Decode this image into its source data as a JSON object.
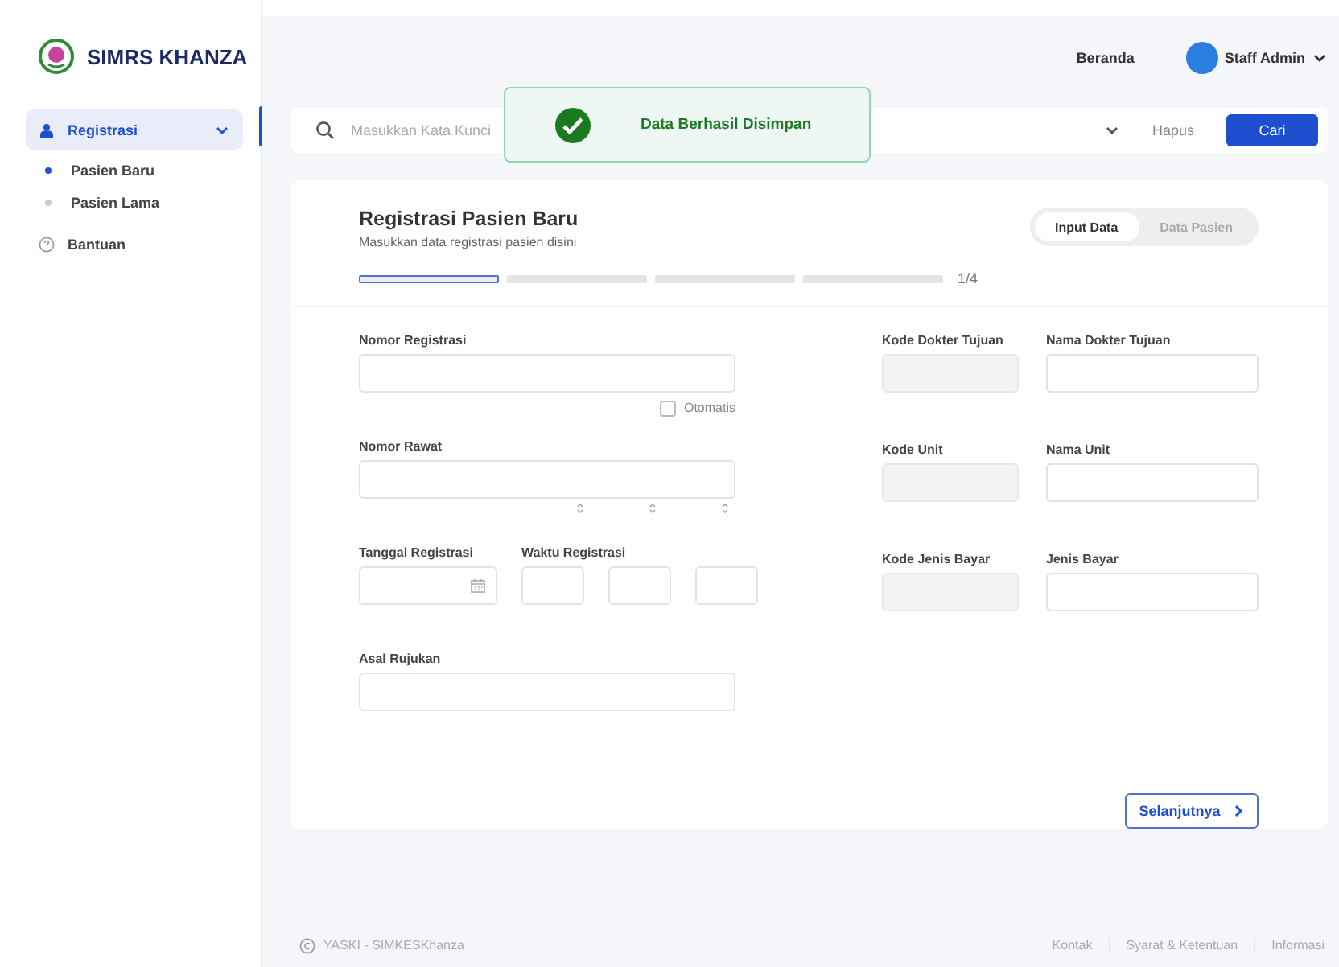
{
  "sidebar": {
    "brand": "SIMRS KHANZA",
    "items": [
      {
        "label": "Registrasi",
        "kind": "group",
        "expanded": true,
        "selected": true
      },
      {
        "label": "Pasien Baru",
        "kind": "sub",
        "selected": true
      },
      {
        "label": "Pasien Lama",
        "kind": "sub",
        "selected": false
      },
      {
        "label": "Bantuan",
        "kind": "help",
        "selected": false
      }
    ]
  },
  "header": {
    "home": "Beranda",
    "user": "Staff Admin"
  },
  "search": {
    "placeholder": "Masukkan Kata Kunci",
    "clear": "Hapus",
    "submit": "Cari"
  },
  "toast": {
    "message": "Data Berhasil Disimpan"
  },
  "card": {
    "title": "Registrasi Pasien Baru",
    "subtitle": "Masukkan data registrasi pasien disini",
    "tabs": [
      {
        "label": "Input Data",
        "selected": true
      },
      {
        "label": "Data Pasien",
        "selected": false
      }
    ],
    "progress": {
      "steps": [
        {
          "selected": true
        },
        {
          "selected": false
        },
        {
          "selected": false
        },
        {
          "selected": false
        }
      ],
      "label": "1/4"
    },
    "left": [
      {
        "kind": "text",
        "label": "Nomor Registrasi",
        "checkbox": {
          "label": "Otomatis",
          "checked": false
        }
      },
      {
        "kind": "text",
        "label": "Nomor Rawat",
        "steppers": true
      },
      {
        "kind": "datetime",
        "label": "Tanggal Registrasi",
        "label2": "Waktu Registrasi"
      },
      {
        "kind": "text",
        "label": "Asal Rujukan"
      }
    ],
    "right": [
      {
        "code": "Kode Dokter Tujuan",
        "name": "Nama Dokter Tujuan"
      },
      {
        "code": "Kode Unit",
        "name": "Nama Unit"
      },
      {
        "code": "Kode Jenis Bayar",
        "name": "Jenis Bayar"
      }
    ],
    "next": "Selanjutnya"
  },
  "footer": {
    "copyright": "YASKI - SIMKESKhanza",
    "links": [
      "Kontak",
      "Syarat & Ketentuan",
      "Informasi"
    ]
  }
}
